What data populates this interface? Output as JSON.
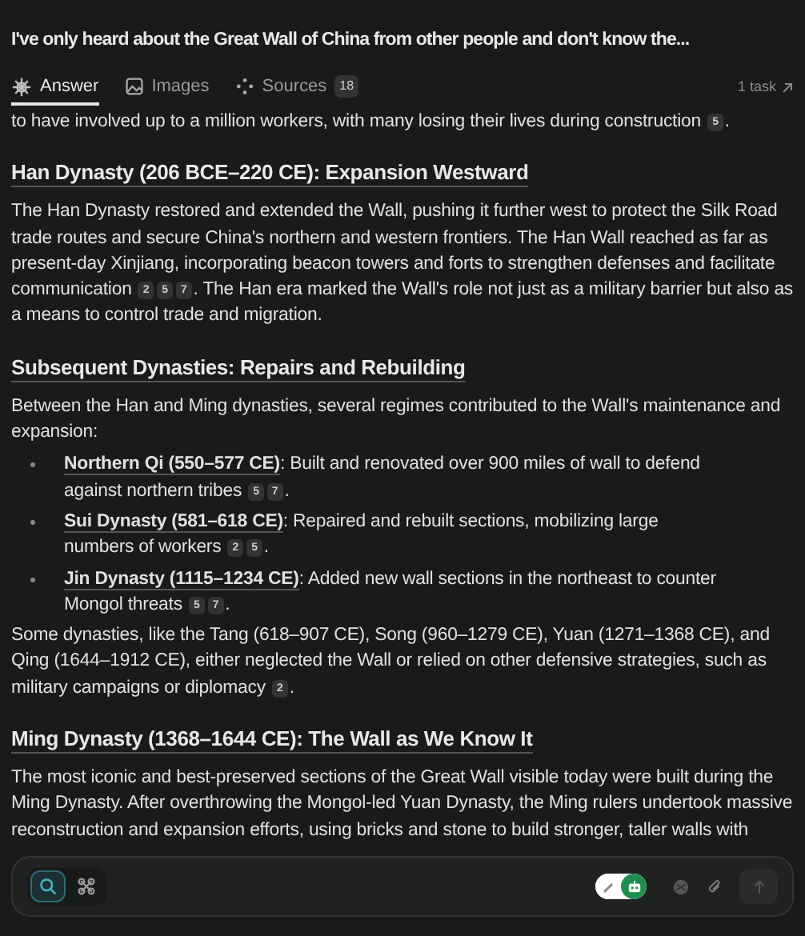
{
  "title": "I've only heard about the Great Wall of China from other people and don't know the...",
  "tabs": [
    {
      "label": "Answer",
      "selected": true
    },
    {
      "label": "Images",
      "selected": false
    },
    {
      "label": "Sources",
      "count": "18",
      "selected": false
    }
  ],
  "task_link": "1 task",
  "content": [
    {
      "kind": "para",
      "parts": [
        {
          "kind": "text",
          "text": "to have involved up to a million workers, with many losing their lives during construction "
        },
        {
          "kind": "cite",
          "text": "5"
        },
        {
          "kind": "text",
          "text": "."
        }
      ]
    },
    {
      "kind": "heading",
      "text": "Han Dynasty (206 BCE–220 CE): Expansion Westward"
    },
    {
      "kind": "para",
      "parts": [
        {
          "kind": "text",
          "text": "The Han Dynasty restored and extended the Wall, pushing it further west to protect the Silk Road trade routes and secure China's northern and western frontiers. The Han Wall reached as far as present-day Xinjiang, incorporating beacon towers and forts to strengthen defenses and facilitate communication "
        },
        {
          "kind": "cite",
          "text": "2"
        },
        {
          "kind": "cite",
          "text": "5"
        },
        {
          "kind": "cite",
          "text": "7"
        },
        {
          "kind": "text",
          "text": ". The Han era marked the Wall's role not just as a military barrier but also as a means to control trade and migration."
        }
      ]
    },
    {
      "kind": "heading",
      "text": "Subsequent Dynasties: Repairs and Rebuilding"
    },
    {
      "kind": "para",
      "parts": [
        {
          "kind": "text",
          "text": "Between the Han and Ming dynasties, several regimes contributed to the Wall's maintenance and expansion:"
        }
      ]
    },
    {
      "kind": "bullets",
      "items": [
        {
          "lead": "Northern Qi (550–577 CE)",
          "parts": [
            {
              "kind": "text",
              "text": ": Built and renovated over 900 miles of wall to defend against northern tribes "
            },
            {
              "kind": "cite",
              "text": "5"
            },
            {
              "kind": "cite",
              "text": "7"
            },
            {
              "kind": "text",
              "text": "."
            }
          ]
        },
        {
          "lead": "Sui Dynasty (581–618 CE)",
          "parts": [
            {
              "kind": "text",
              "text": ": Repaired and rebuilt sections, mobilizing large numbers of workers "
            },
            {
              "kind": "cite",
              "text": "2"
            },
            {
              "kind": "cite",
              "text": "5"
            },
            {
              "kind": "text",
              "text": "."
            }
          ]
        },
        {
          "lead": "Jin Dynasty (1115–1234 CE)",
          "parts": [
            {
              "kind": "text",
              "text": ": Added new wall sections in the northeast to counter Mongol threats "
            },
            {
              "kind": "cite",
              "text": "5"
            },
            {
              "kind": "cite",
              "text": "7"
            },
            {
              "kind": "text",
              "text": "."
            }
          ]
        }
      ]
    },
    {
      "kind": "para",
      "parts": [
        {
          "kind": "text",
          "text": "Some dynasties, like the Tang (618–907 CE), Song (960–1279 CE), Yuan (1271–1368 CE), and Qing (1644–1912 CE), either neglected the Wall or relied on other defensive strategies, such as military campaigns or diplomacy "
        },
        {
          "kind": "cite",
          "text": "2"
        },
        {
          "kind": "text",
          "text": "."
        }
      ]
    },
    {
      "kind": "heading",
      "text": "Ming Dynasty (1368–1644 CE): The Wall as We Know It"
    },
    {
      "kind": "para",
      "parts": [
        {
          "kind": "text",
          "text": "The most iconic and best-preserved sections of the Great Wall visible today were built during the Ming Dynasty. After overthrowing the Mongol-led Yuan Dynasty, the Ming rulers undertook massive reconstruction and expansion efforts, using bricks and stone to build stronger, taller walls with"
        }
      ]
    }
  ],
  "composer": {
    "modes": [
      {
        "selected": true
      },
      {
        "selected": false
      }
    ],
    "model_switch": [
      {
        "selected": false
      },
      {
        "selected": true
      }
    ],
    "send": {
      "disabled": true
    }
  }
}
